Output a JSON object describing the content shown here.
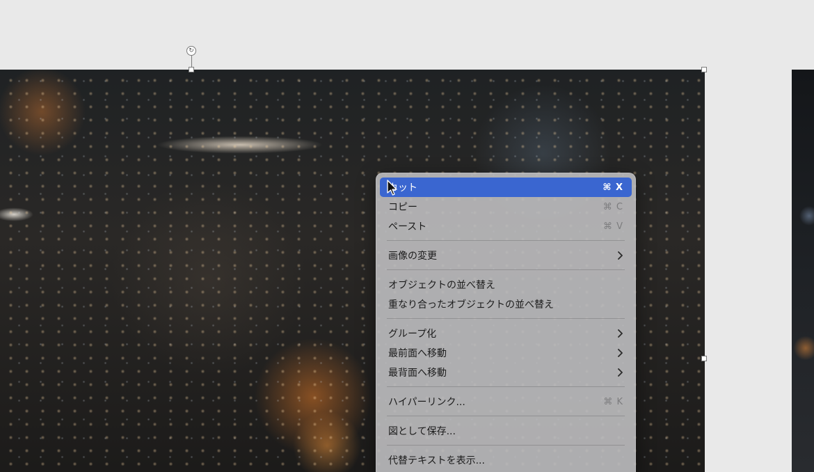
{
  "canvas": {
    "background_color": "#e9e9e9"
  },
  "selection": {
    "rotate_glyph": "↻"
  },
  "context_menu": {
    "background_color": "#bebec0",
    "highlight_color": "#3a66d0",
    "groups": [
      [
        {
          "label": "カット",
          "shortcut": "⌘ X",
          "highlighted": true
        },
        {
          "label": "コピー",
          "shortcut": "⌘ C"
        },
        {
          "label": "ペースト",
          "shortcut": "⌘ V"
        }
      ],
      [
        {
          "label": "画像の変更",
          "submenu": true
        }
      ],
      [
        {
          "label": "オブジェクトの並べ替え"
        },
        {
          "label": "重なり合ったオブジェクトの並べ替え"
        }
      ],
      [
        {
          "label": "グループ化",
          "submenu": true
        },
        {
          "label": "最前面へ移動",
          "submenu": true
        },
        {
          "label": "最背面へ移動",
          "submenu": true
        }
      ],
      [
        {
          "label": "ハイパーリンク...",
          "shortcut": "⌘ K"
        }
      ],
      [
        {
          "label": "図として保存..."
        }
      ],
      [
        {
          "label": "代替テキストを表示..."
        }
      ]
    ]
  }
}
